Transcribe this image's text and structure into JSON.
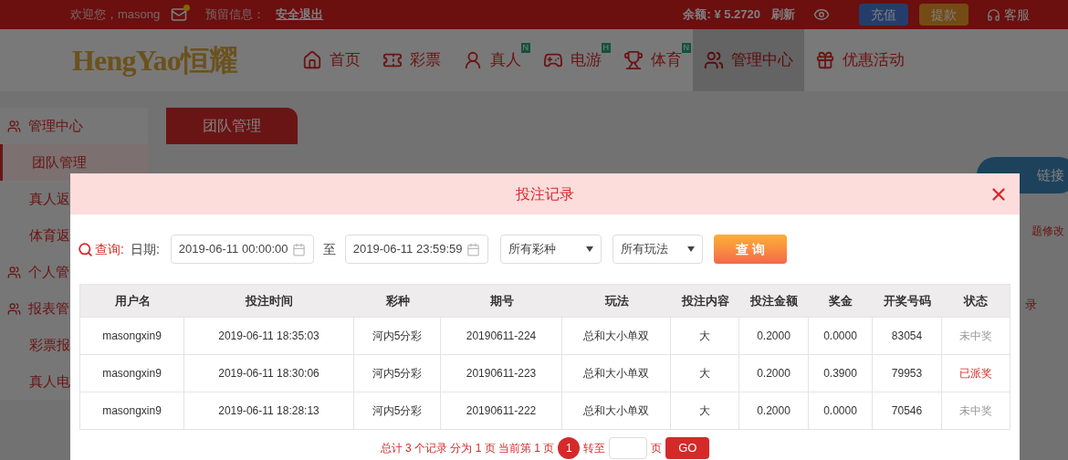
{
  "top_bar": {
    "welcome": "欢迎您，masong",
    "has_message": true,
    "reserved_label": "预留信息：",
    "logout": "安全退出",
    "balance": "余额: ¥ 5.2720",
    "refresh": "刷新",
    "deposit": "充值",
    "withdraw": "提款",
    "service": "客服"
  },
  "logo": "HengYao恒耀",
  "nav": [
    {
      "label": "首页",
      "selected": false
    },
    {
      "label": "彩票",
      "selected": false
    },
    {
      "label": "真人",
      "badge": "N",
      "selected": false
    },
    {
      "label": "电游",
      "badge": "H",
      "selected": false
    },
    {
      "label": "体育",
      "badge": "N",
      "selected": false
    },
    {
      "label": "管理中心",
      "selected": true
    },
    {
      "label": "优惠活动",
      "selected": false
    }
  ],
  "sidebar": {
    "items": [
      {
        "label": "管理中心",
        "kind": "section",
        "selected": false
      },
      {
        "label": "团队管理",
        "kind": "item",
        "selected": true
      },
      {
        "label": "真人返",
        "kind": "item",
        "selected": false
      },
      {
        "label": "体育返",
        "kind": "item",
        "selected": false
      },
      {
        "label": "个人管",
        "kind": "section",
        "selected": false
      },
      {
        "label": "报表管",
        "kind": "section",
        "selected": false
      },
      {
        "label": "彩票报",
        "kind": "item",
        "selected": false
      },
      {
        "label": "真人电",
        "kind": "item",
        "selected": false
      }
    ]
  },
  "content": {
    "tab": "团队管理",
    "link_button": "链接",
    "note": "题修改",
    "column_fragment": "录"
  },
  "dialog": {
    "title": "投注记录",
    "filters": {
      "search_label": "查询:",
      "date_label": "日期:",
      "date_from": "2019-06-11 00:00:00",
      "separator": "至",
      "date_to": "2019-06-11 23:59:59",
      "lottery_select": "所有彩种",
      "play_select": "所有玩法",
      "query_button": "查 询"
    },
    "table": {
      "columns": [
        "用户名",
        "投注时间",
        "彩种",
        "期号",
        "玩法",
        "投注内容",
        "投注金额",
        "奖金",
        "开奖号码",
        "状态"
      ],
      "rows": [
        {
          "cells": [
            "masongxin9",
            "2019-06-11 18:35:03",
            "河内5分彩",
            "20190611-224",
            "总和大小单双",
            "大",
            "0.2000",
            "0.0000",
            "83054"
          ],
          "status": {
            "text": "未中奖",
            "kind": "lost"
          }
        },
        {
          "cells": [
            "masongxin9",
            "2019-06-11 18:30:06",
            "河内5分彩",
            "20190611-223",
            "总和大小单双",
            "大",
            "0.2000",
            "0.3900",
            "79953"
          ],
          "status": {
            "text": "已派奖",
            "kind": "paid"
          }
        },
        {
          "cells": [
            "masongxin9",
            "2019-06-11 18:28:13",
            "河内5分彩",
            "20190611-222",
            "总和大小单双",
            "大",
            "0.2000",
            "0.0000",
            "70546"
          ],
          "status": {
            "text": "未中奖",
            "kind": "lost"
          }
        }
      ]
    },
    "pagination": {
      "summary": "总计 3 个记录 分为 1 页 当前第 1 页",
      "pages": [
        {
          "label": "1",
          "selected": true
        }
      ],
      "goto_label": "转至",
      "page_unit": "页",
      "go_button": "GO"
    }
  }
}
